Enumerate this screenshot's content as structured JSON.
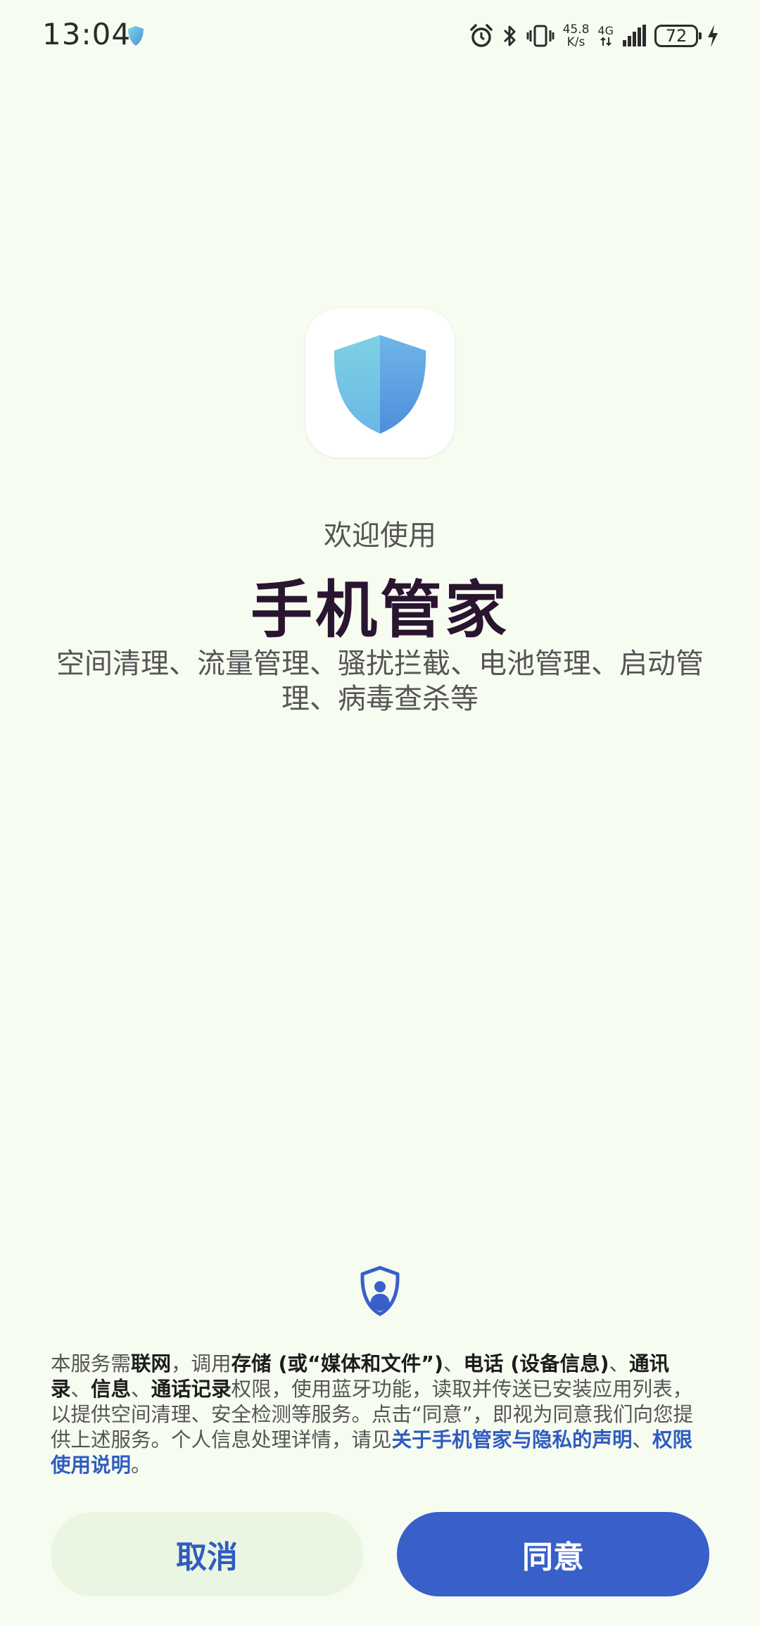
{
  "status_bar": {
    "time": "13:04",
    "net_speed_value": "45.8",
    "net_speed_unit": "K/s",
    "net_type": "4G",
    "battery": "72",
    "icons": [
      "shield-icon",
      "alarm-icon",
      "bluetooth-icon",
      "vibrate-icon",
      "signal-icon",
      "battery-icon",
      "charging-icon"
    ]
  },
  "welcome": {
    "greeting": "欢迎使用",
    "app_name": "手机管家",
    "features": "空间清理、流量管理、骚扰拦截、电池管理、启动管理、病毒查杀等"
  },
  "privacy": {
    "icon": "privacy-user-shield-icon",
    "t1": "本服务需",
    "s_network": "联网",
    "t2": "，调用",
    "s_storage": "存储 (或“媒体和文件”)",
    "t3": "、",
    "s_phone": "电话 (设备信息)",
    "t4": "、",
    "s_contacts": "通讯录",
    "t5": "、",
    "s_sms": "信息",
    "t6": "、",
    "s_calllog": "通话记录",
    "t7": "权限，使用蓝牙功能，读取并传送已安装应用列表，以提供空间清理、安全检测等服务。点击“同意”，即视为同意我们向您提供上述服务。个人信息处理详情，请见",
    "link_privacy": "关于手机管家与隐私的声明",
    "t8": "、",
    "link_permissions": "权限使用说明",
    "t9": "。"
  },
  "buttons": {
    "cancel": "取消",
    "agree": "同意"
  },
  "colors": {
    "background": "#F7FCF1",
    "accent": "#3860C8",
    "link": "#2F5CC0",
    "cancel_bg": "#EAF6E1",
    "title": "#2A1530"
  }
}
